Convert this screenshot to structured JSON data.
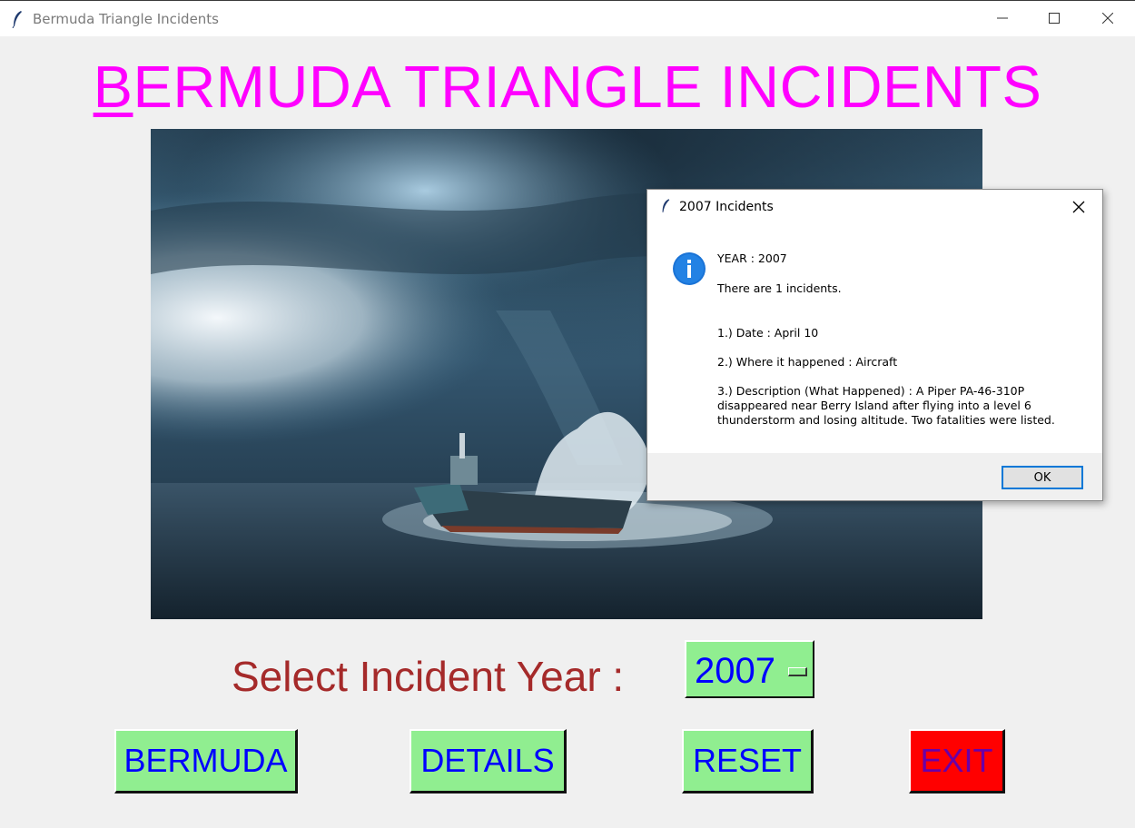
{
  "window": {
    "title": "Bermuda Triangle Incidents"
  },
  "header": {
    "title_first_letter": "B",
    "title_rest": "ERMUDA TRIANGLE INCIDENTS"
  },
  "scene": {
    "description_icon": "storm-ship-image"
  },
  "year_selector": {
    "label": "Select Incident Year  :",
    "value": "2007"
  },
  "buttons": {
    "bermuda": "BERMUDA",
    "details": "DETAILS",
    "reset": "RESET",
    "exit": "EXIT"
  },
  "dialog": {
    "title": "2007 Incidents",
    "year_line": "YEAR  :  2007",
    "count_line": "There are  1  incidents.",
    "date_line": "1.)  Date  :  April 10",
    "where_line": "2.)  Where it happened  :  Aircraft",
    "description_line": "3.)  Description (What Happened)  :  A Piper PA-46-310P disappeared near Berry Island after flying into a level 6 thunderstorm and losing altitude. Two fatalities were listed.",
    "ok_label": "OK"
  },
  "colors": {
    "title": "#ff00ff",
    "year_label": "#a52a2a",
    "button_bg": "#90ee90",
    "button_text": "#0000ff",
    "exit_bg": "#ff0000",
    "exit_text": "#6a00a8"
  }
}
